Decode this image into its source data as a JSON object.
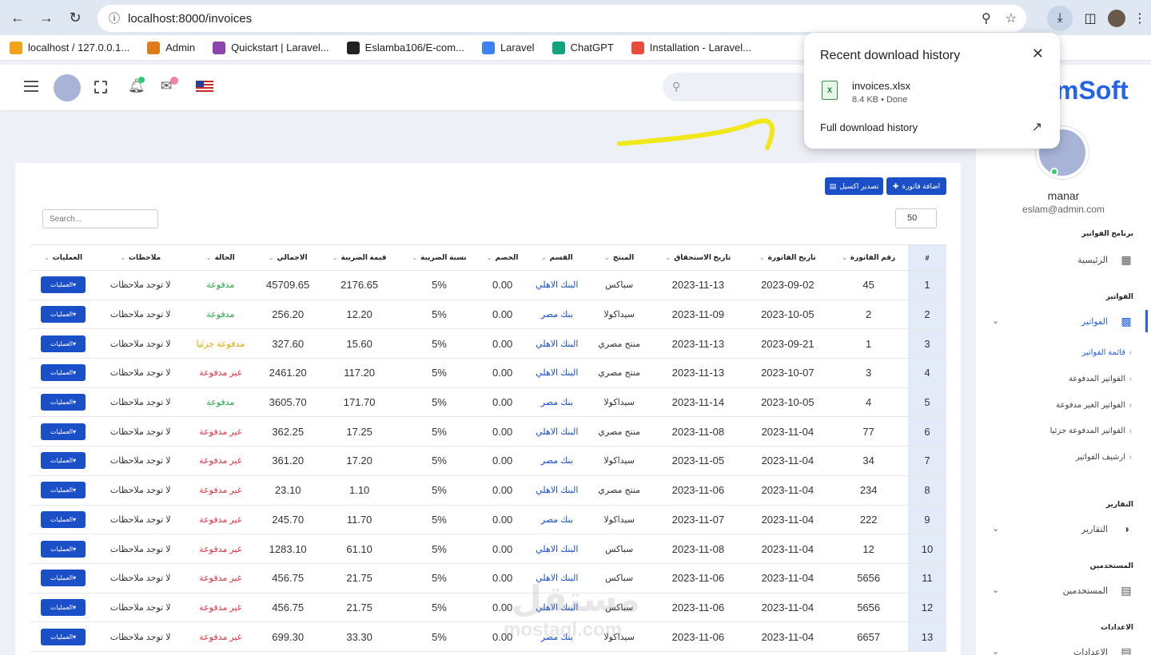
{
  "browser": {
    "url": "localhost:8000/invoices",
    "bookmarks": [
      {
        "label": "localhost / 127.0.0.1...",
        "color": "#f3a21b"
      },
      {
        "label": "Admin",
        "color": "#e07b19"
      },
      {
        "label": "Quickstart | Laravel...",
        "color": "#8e44ad"
      },
      {
        "label": "Eslamba106/E-com...",
        "color": "#222222"
      },
      {
        "label": "Laravel",
        "color": "#3b82f6"
      },
      {
        "label": "ChatGPT",
        "color": "#10a37f"
      },
      {
        "label": "Installation - Laravel...",
        "color": "#e74c3c"
      }
    ]
  },
  "download_popup": {
    "title": "Recent download history",
    "file_name": "invoices.xlsx",
    "file_meta": "8.4 KB • Done",
    "full_history": "Full download history"
  },
  "header": {
    "brand": "mSoft"
  },
  "sidebar": {
    "user_name": "manar",
    "user_email": "eslam@admin.com",
    "sections": {
      "program": "برنامج الفواتير",
      "invoices": "الفواتير",
      "reports": "التقارير",
      "users": "المستخدمين",
      "settings": "الاعدادات"
    },
    "items": {
      "home": "الرئيسية",
      "invoices": "الفواتير",
      "reports": "التقارير",
      "users": "المستخدمين",
      "settings": "الاعدادات"
    },
    "subitems": [
      "قائمة الفواتير",
      "الفواتير المدفوعة",
      "الفواتير الغير مدفوعة",
      "الفواتير المدفوعة جزئيا",
      "ارشيف الفواتير"
    ]
  },
  "toolbar": {
    "add_label": "اضافة فاتورة",
    "export_label": "تصدير اكسيل",
    "search_placeholder": "Search...",
    "per_page": "50"
  },
  "table": {
    "headers": [
      "#",
      "رقم الفاتورة",
      "تاريخ الفاتورة",
      "تاريخ الاستحقاق",
      "المنتج",
      "القسم",
      "الخصم",
      "نسبة الضريبة",
      "قيمة الضريبة",
      "الاجمالي",
      "الحالة",
      "ملاحظات",
      "العمليات"
    ],
    "ops_label": "العمليات",
    "rows": [
      {
        "idx": "1",
        "num": "45",
        "date": "2023-09-02",
        "due": "2023-11-13",
        "product": "سباكس",
        "dept": "البنك الاهلي",
        "discount": "0.00",
        "rate": "5%",
        "tax": "2176.65",
        "total": "45709.65",
        "status": "مدفوعة",
        "status_type": "paid",
        "notes": "لا توجد ملاحظات"
      },
      {
        "idx": "2",
        "num": "2",
        "date": "2023-10-05",
        "due": "2023-11-09",
        "product": "سيداكولا",
        "dept": "بنك مصر",
        "discount": "0.00",
        "rate": "5%",
        "tax": "12.20",
        "total": "256.20",
        "status": "مدفوعة",
        "status_type": "paid",
        "notes": "لا توجد ملاحظات"
      },
      {
        "idx": "3",
        "num": "1",
        "date": "2023-09-21",
        "due": "2023-11-13",
        "product": "منتج مصري",
        "dept": "البنك الاهلي",
        "discount": "0.00",
        "rate": "5%",
        "tax": "15.60",
        "total": "327.60",
        "status": "مدفوعة جزئيا",
        "status_type": "partial",
        "notes": "لا توجد ملاحظات"
      },
      {
        "idx": "4",
        "num": "3",
        "date": "2023-10-07",
        "due": "2023-11-13",
        "product": "منتج مصري",
        "dept": "البنك الاهلي",
        "discount": "0.00",
        "rate": "5%",
        "tax": "117.20",
        "total": "2461.20",
        "status": "غير مدفوعة",
        "status_type": "unpaid",
        "notes": "لا توجد ملاحظات"
      },
      {
        "idx": "5",
        "num": "4",
        "date": "2023-10-05",
        "due": "2023-11-14",
        "product": "سيداكولا",
        "dept": "بنك مصر",
        "discount": "0.00",
        "rate": "5%",
        "tax": "171.70",
        "total": "3605.70",
        "status": "مدفوعة",
        "status_type": "paid",
        "notes": "لا توجد ملاحظات"
      },
      {
        "idx": "6",
        "num": "77",
        "date": "2023-11-04",
        "due": "2023-11-08",
        "product": "منتج مصري",
        "dept": "البنك الاهلي",
        "discount": "0.00",
        "rate": "5%",
        "tax": "17.25",
        "total": "362.25",
        "status": "غير مدفوعة",
        "status_type": "unpaid",
        "notes": "لا توجد ملاحظات"
      },
      {
        "idx": "7",
        "num": "34",
        "date": "2023-11-04",
        "due": "2023-11-05",
        "product": "سيداكولا",
        "dept": "بنك مصر",
        "discount": "0.00",
        "rate": "5%",
        "tax": "17.20",
        "total": "361.20",
        "status": "غير مدفوعة",
        "status_type": "unpaid",
        "notes": "لا توجد ملاحظات"
      },
      {
        "idx": "8",
        "num": "234",
        "date": "2023-11-04",
        "due": "2023-11-06",
        "product": "منتج مصري",
        "dept": "البنك الاهلي",
        "discount": "0.00",
        "rate": "5%",
        "tax": "1.10",
        "total": "23.10",
        "status": "غير مدفوعة",
        "status_type": "unpaid",
        "notes": "لا توجد ملاحظات"
      },
      {
        "idx": "9",
        "num": "222",
        "date": "2023-11-04",
        "due": "2023-11-07",
        "product": "سيداكولا",
        "dept": "بنك مصر",
        "discount": "0.00",
        "rate": "5%",
        "tax": "11.70",
        "total": "245.70",
        "status": "غير مدفوعة",
        "status_type": "unpaid",
        "notes": "لا توجد ملاحظات"
      },
      {
        "idx": "10",
        "num": "12",
        "date": "2023-11-04",
        "due": "2023-11-08",
        "product": "سباكس",
        "dept": "البنك الاهلي",
        "discount": "0.00",
        "rate": "5%",
        "tax": "61.10",
        "total": "1283.10",
        "status": "غير مدفوعة",
        "status_type": "unpaid",
        "notes": "لا توجد ملاحظات"
      },
      {
        "idx": "11",
        "num": "5656",
        "date": "2023-11-04",
        "due": "2023-11-06",
        "product": "سباكس",
        "dept": "البنك الاهلي",
        "discount": "0.00",
        "rate": "5%",
        "tax": "21.75",
        "total": "456.75",
        "status": "غير مدفوعة",
        "status_type": "unpaid",
        "notes": "لا توجد ملاحظات"
      },
      {
        "idx": "12",
        "num": "5656",
        "date": "2023-11-04",
        "due": "2023-11-06",
        "product": "سباكس",
        "dept": "البنك الاهلي",
        "discount": "0.00",
        "rate": "5%",
        "tax": "21.75",
        "total": "456.75",
        "status": "غير مدفوعة",
        "status_type": "unpaid",
        "notes": "لا توجد ملاحظات"
      },
      {
        "idx": "13",
        "num": "6657",
        "date": "2023-11-04",
        "due": "2023-11-06",
        "product": "سيداكولا",
        "dept": "بنك مصر",
        "discount": "0.00",
        "rate": "5%",
        "tax": "33.30",
        "total": "699.30",
        "status": "غير مدفوعة",
        "status_type": "unpaid",
        "notes": "لا توجد ملاحظات"
      }
    ]
  },
  "watermark": {
    "text": "مستقل",
    "sub": "mostaql.com"
  }
}
